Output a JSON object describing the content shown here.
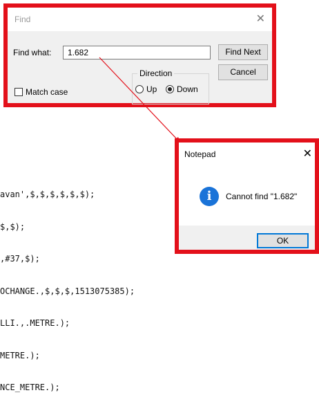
{
  "background_code": {
    "lines": [
      "avan',$,$,$,$,$,$);",
      "$,$);",
      ",#37,$);",
      "OCHANGE.,$,$,$,1513075385);",
      "LLI.,.METRE.);",
      "METRE.);",
      "NCE_METRE.);"
    ]
  },
  "find_dialog": {
    "title": "Find",
    "find_what_label": "Find what:",
    "find_what_value": "1.682",
    "find_next_label": "Find Next",
    "cancel_label": "Cancel",
    "direction_label": "Direction",
    "up_label": "Up",
    "down_label": "Down",
    "direction_selected": "Down",
    "match_case_label": "Match case",
    "match_case_checked": false
  },
  "message_box": {
    "title": "Notepad",
    "message": "Cannot find \"1.682\"",
    "ok_label": "OK",
    "icon": "info-icon"
  },
  "colors": {
    "highlight_border": "#e3101a",
    "dialog_bg": "#f0f0f0",
    "default_button_border": "#0078d7",
    "info_icon": "#1a73d8"
  }
}
